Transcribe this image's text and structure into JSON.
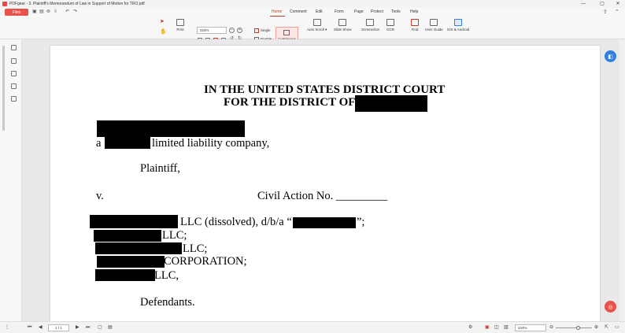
{
  "window": {
    "title": "PDFgear - 3. Plaintiff's Memorandum of Law in Support of Motion for TRO.pdf",
    "minimize": "—",
    "maximize": "▢",
    "close": "✕"
  },
  "toolbar": {
    "files_label": "Files",
    "menus": [
      "Home",
      "Comment",
      "Edit",
      "Form",
      "Page",
      "Protect",
      "Tools",
      "Help"
    ],
    "active_menu": "Home",
    "print_label": "Print",
    "zoom_value": "224%",
    "single_label": "Single",
    "double_label": "Double",
    "continuous_label": "Continuous",
    "auto_scroll_label": "Auto Scroll ▾",
    "slide_show_label": "Slide Show",
    "screenshot_label": "Screenshot",
    "ocr_label": "OCR",
    "find_label": "Find",
    "user_guide_label": "User Guide",
    "ios_android_label": "iOS & Android"
  },
  "document": {
    "heading_line1": "IN THE UNITED STATES DISTRICT COURT",
    "heading_line2": "FOR THE DISTRICT OF",
    "line_a": "a",
    "llc_company": "limited liability company,",
    "plaintiff": "Plaintiff,",
    "versus": "v.",
    "civil_action": "Civil Action No. _________",
    "def1_text": "LLC (dissolved), d/b/a “",
    "def1_end": "”;",
    "def2_text": "LLC;",
    "def3_text": "LLC;",
    "def4_text": "CORPORATION;",
    "def5_text": "LLC,",
    "defendants": "Defendants."
  },
  "statusbar": {
    "page_indicator": "1 / 1",
    "zoom_value": "224%"
  },
  "colors": {
    "accent": "#e8524a",
    "blue_button": "#2f7ee0",
    "red_button": "#e8524a"
  }
}
